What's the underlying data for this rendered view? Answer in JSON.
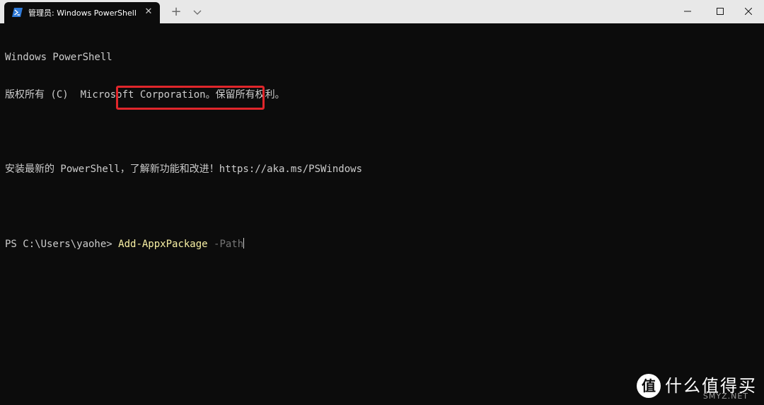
{
  "window": {
    "tab_title": "管理员: Windows PowerShell",
    "tab_icon": "powershell-icon",
    "new_tab_label": "+",
    "close_tab_label": "✕"
  },
  "terminal": {
    "lines": [
      "Windows PowerShell",
      "版权所有 (C)  Microsoft Corporation。保留所有权利。",
      "",
      "安装最新的 PowerShell，了解新功能和改进！https://aka.ms/PSWindows",
      ""
    ],
    "prompt": "PS C:\\Users\\yaohe> ",
    "command": "Add-AppxPackage",
    "parameter": " -Path"
  },
  "watermark": {
    "logo_char": "值",
    "text": "什么值得买",
    "sub": "SMYZ.NET"
  },
  "colors": {
    "background": "#0c0c0c",
    "text": "#cccccc",
    "command": "#f9f1a5",
    "parameter": "#767676",
    "highlight": "#e0262b",
    "titlebar": "#e8e8e8"
  }
}
